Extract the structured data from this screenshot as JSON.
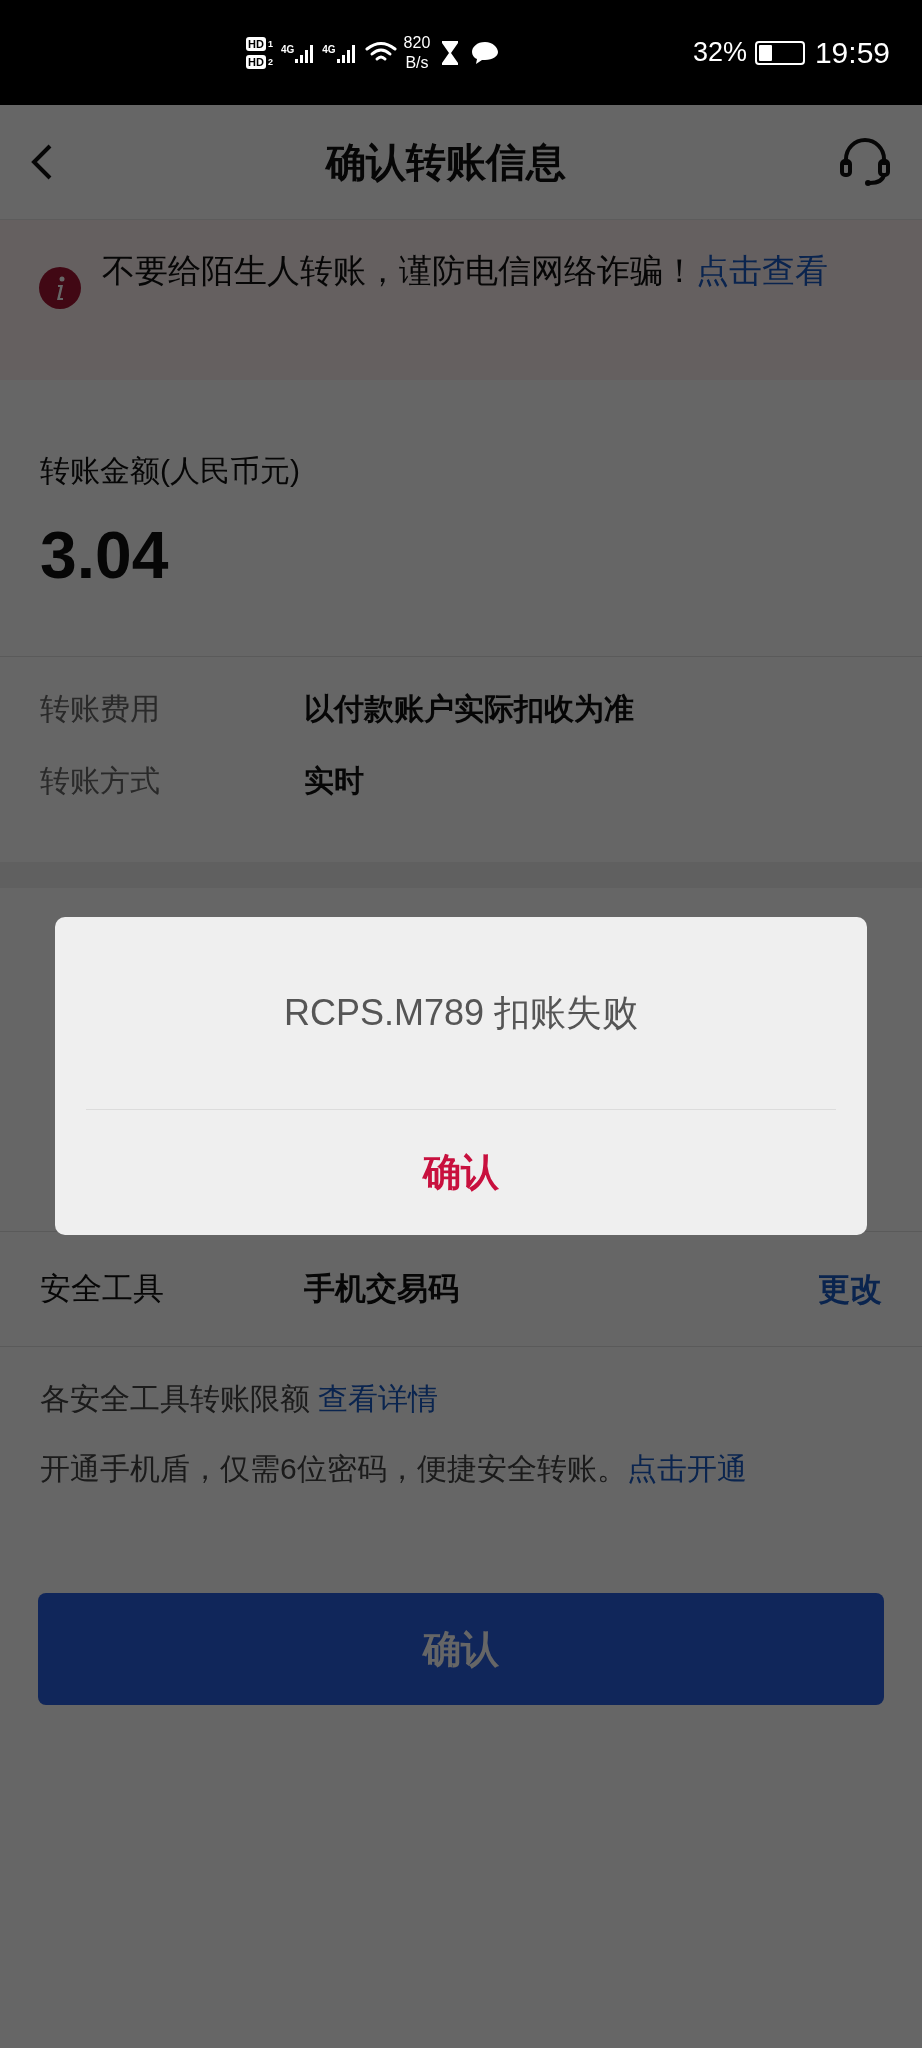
{
  "status_bar": {
    "sim_labels": [
      "HD",
      "HD"
    ],
    "sim_numbers": [
      "1",
      "2"
    ],
    "network": [
      "4G",
      "4G"
    ],
    "speed_value": "820",
    "speed_unit": "B/s",
    "battery_percent": "32%",
    "battery": {
      "level": 0.32
    },
    "time": "19:59"
  },
  "header": {
    "title": "确认转账信息"
  },
  "warning": {
    "text": "不要给陌生人转账，谨防电信网络诈骗！",
    "link": "点击查看"
  },
  "amount": {
    "label": "转账金额(人民币元)",
    "value": "3.04"
  },
  "details": [
    {
      "label": "转账费用",
      "value": "以付款账户实际扣收为准"
    },
    {
      "label": "转账方式",
      "value": "实时"
    }
  ],
  "security": {
    "label": "安全工具",
    "value": "手机交易码",
    "action": "更改"
  },
  "limits": {
    "text": "各安全工具转账限额",
    "link": "查看详情"
  },
  "promo": {
    "text": "开通手机盾，仅需6位密码，便捷安全转账。",
    "link": "点击开通"
  },
  "confirm_button": "确认",
  "dialog": {
    "message": "RCPS.M789 扣账失败",
    "button": "确认"
  }
}
